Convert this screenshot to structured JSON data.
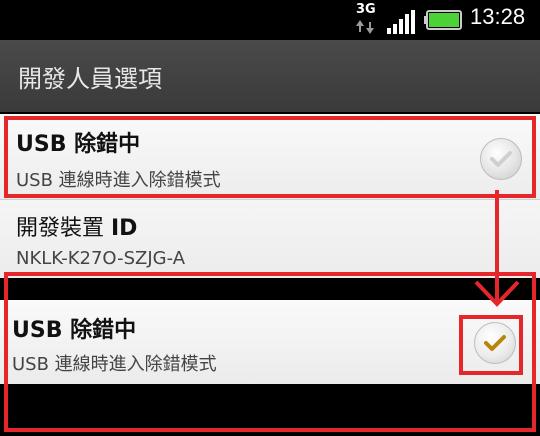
{
  "status_bar": {
    "network": "3G",
    "time": "13:28"
  },
  "title_bar": {
    "title": "開發人員選項"
  },
  "prefs": [
    {
      "title_prefix": "USB",
      "title_rest": " 除錯中",
      "summary": "USB 連線時進入除錯模式",
      "checked": false
    },
    {
      "title_prefix": "開發裝置 ",
      "title_rest": "ID",
      "summary": "NKLK-K27O-SZJG-A"
    }
  ],
  "zoom_pref": {
    "title_prefix": "USB",
    "title_rest": " 除錯中",
    "summary": "USB 連線時進入除錯模式",
    "checked": true
  },
  "colors": {
    "annotation": "#e5262a",
    "check_gold": "#b8860b",
    "battery": "#4cd137"
  }
}
